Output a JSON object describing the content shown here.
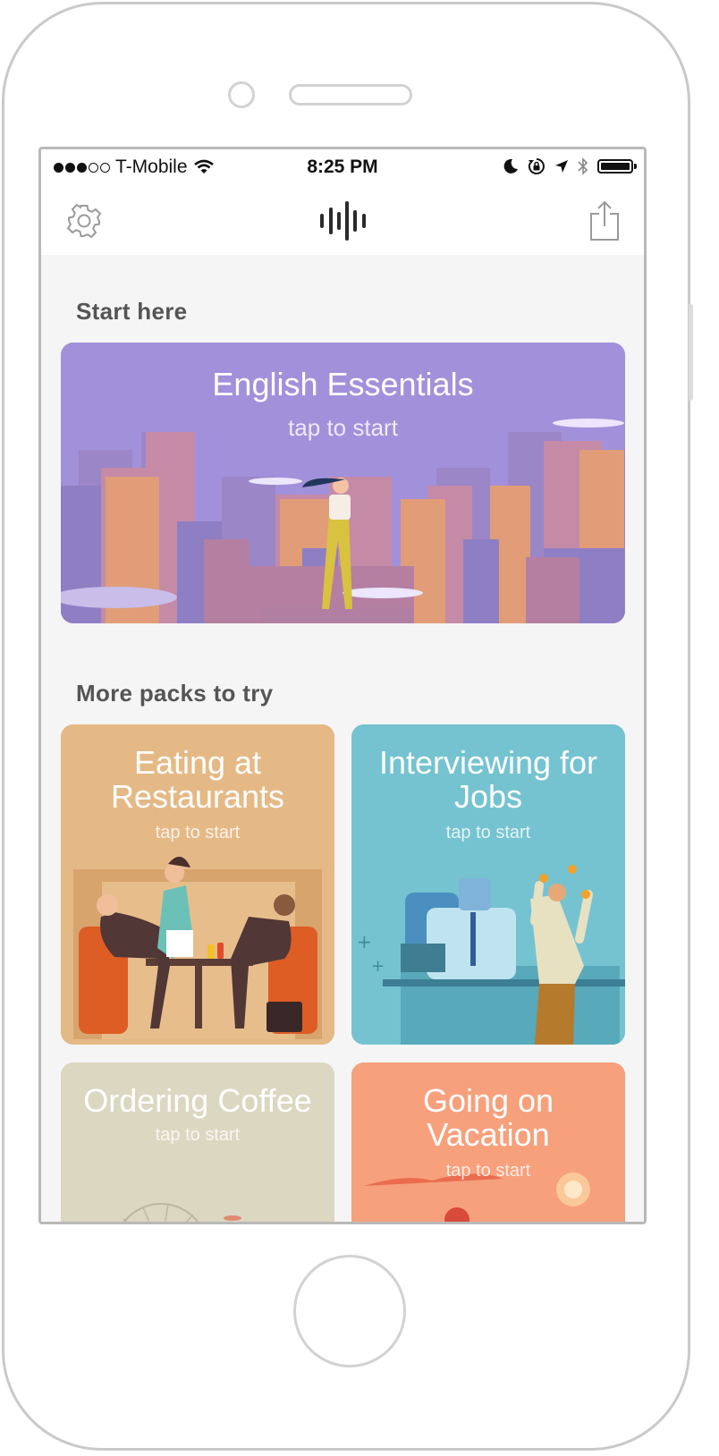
{
  "status_bar": {
    "carrier": "T-Mobile",
    "time": "8:25 PM",
    "signal_bars": 3,
    "signal_total": 5
  },
  "nav": {
    "settings_icon": "gear-icon",
    "logo_icon": "soundwave-logo-icon",
    "share_icon": "share-icon"
  },
  "sections": {
    "start_here": "Start here",
    "more_packs": "More packs to try"
  },
  "featured": {
    "title": "English Essentials",
    "subtitle": "tap to start",
    "color": "#a08fd8"
  },
  "packs": [
    {
      "title_line1": "Eating at",
      "title_line2": "Restaurants",
      "subtitle": "tap to start",
      "color": "#e4b985"
    },
    {
      "title_line1": "Interviewing for",
      "title_line2": "Jobs",
      "subtitle": "tap to start",
      "color": "#75c2cf"
    },
    {
      "title_line1": "Ordering Coffee",
      "title_line2": "",
      "subtitle": "tap to start",
      "color": "#dbd6c0"
    },
    {
      "title_line1": "Going on",
      "title_line2": "Vacation",
      "subtitle": "tap to start",
      "color": "#f7a07c"
    }
  ]
}
